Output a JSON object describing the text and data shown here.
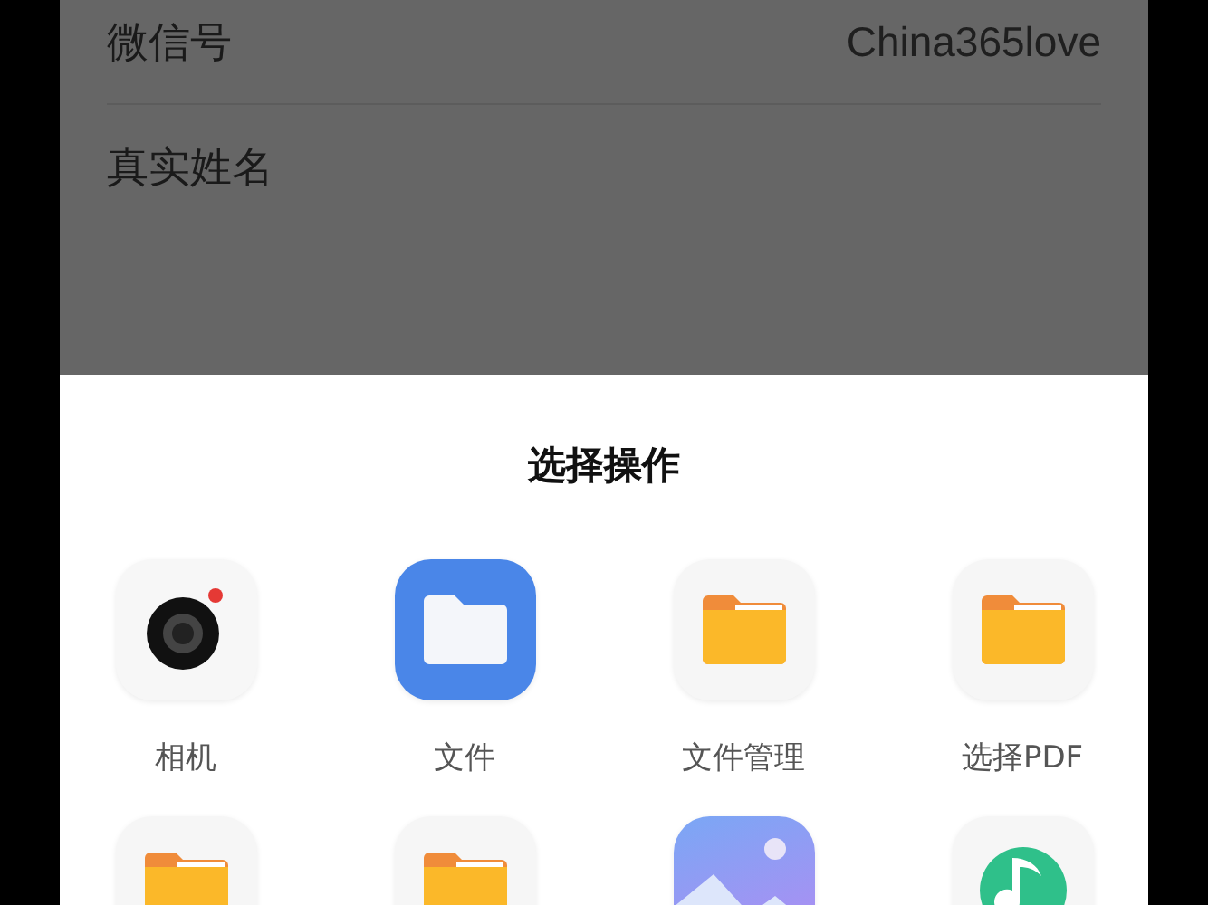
{
  "profile_rows": [
    {
      "label": "微信号",
      "value": "China365love"
    },
    {
      "label": "真实姓名"
    }
  ],
  "sheet": {
    "title": "选择操作",
    "apps": [
      {
        "kind": "camera",
        "label": "相机"
      },
      {
        "kind": "files",
        "label": "文件"
      },
      {
        "kind": "folder",
        "label": "文件管理"
      },
      {
        "kind": "folder",
        "label": "选择PDF"
      },
      {
        "kind": "folder"
      },
      {
        "kind": "folder"
      },
      {
        "kind": "gallery"
      },
      {
        "kind": "music"
      }
    ]
  }
}
